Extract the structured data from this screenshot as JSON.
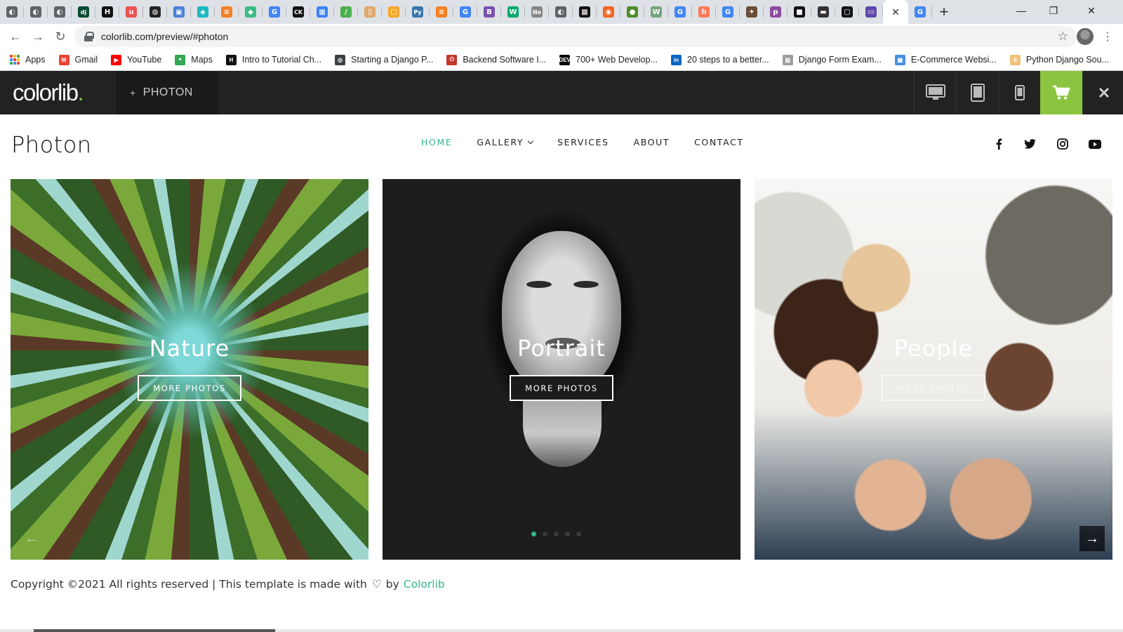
{
  "browser": {
    "tabs": [
      {
        "icon": "globe-icon",
        "color": "#5f6368",
        "glyph": "◐"
      },
      {
        "icon": "globe-icon",
        "color": "#5f6368",
        "glyph": "◐"
      },
      {
        "icon": "globe-icon",
        "color": "#5f6368",
        "glyph": "◐"
      },
      {
        "icon": "django-icon",
        "color": "#0c4b33",
        "glyph": "dj"
      },
      {
        "icon": "hackernoon-icon",
        "color": "#111111",
        "glyph": "H"
      },
      {
        "icon": "udemy-icon",
        "color": "#ec5252",
        "glyph": "u"
      },
      {
        "icon": "github-icon",
        "color": "#222222",
        "glyph": "◍"
      },
      {
        "icon": "gmail-icon",
        "color": "#4a7fd4",
        "glyph": "▣"
      },
      {
        "icon": "teal-icon",
        "color": "#1db9c3",
        "glyph": "◈"
      },
      {
        "icon": "stackoverflow-icon",
        "color": "#f48024",
        "glyph": "≡"
      },
      {
        "icon": "shield-icon",
        "color": "#3dbb86",
        "glyph": "◆"
      },
      {
        "icon": "google-icon",
        "color": "#4285f4",
        "glyph": "G"
      },
      {
        "icon": "ck-icon",
        "color": "#111111",
        "glyph": "CK"
      },
      {
        "icon": "grid-icon",
        "color": "#3b82f6",
        "glyph": "▦"
      },
      {
        "icon": "pen-icon",
        "color": "#4caf50",
        "glyph": "/"
      },
      {
        "icon": "doc-icon",
        "color": "#e0a96d",
        "glyph": "▯"
      },
      {
        "icon": "orange-icon",
        "color": "#f5a623",
        "glyph": "▢"
      },
      {
        "icon": "python-icon",
        "color": "#3776ab",
        "glyph": "Py"
      },
      {
        "icon": "stackoverflow-icon",
        "color": "#f48024",
        "glyph": "≡"
      },
      {
        "icon": "google-icon",
        "color": "#4285f4",
        "glyph": "G"
      },
      {
        "icon": "bootstrap-icon",
        "color": "#7952b3",
        "glyph": "B"
      },
      {
        "icon": "w3schools-icon",
        "color": "#04aa6d",
        "glyph": "W"
      },
      {
        "icon": "new-icon",
        "color": "#888888",
        "glyph": "Ne"
      },
      {
        "icon": "globe-icon",
        "color": "#5f6368",
        "glyph": "◐"
      },
      {
        "icon": "qr-icon",
        "color": "#111111",
        "glyph": "▩"
      },
      {
        "icon": "orange-icon",
        "color": "#f26522",
        "glyph": "◉"
      },
      {
        "icon": "green-icon",
        "color": "#4c8c2b",
        "glyph": "●"
      },
      {
        "icon": "w-icon",
        "color": "#74a57f",
        "glyph": "W"
      },
      {
        "icon": "google-icon",
        "color": "#4285f4",
        "glyph": "G"
      },
      {
        "icon": "hubspot-icon",
        "color": "#ff7a59",
        "glyph": "h"
      },
      {
        "icon": "google-icon",
        "color": "#4285f4",
        "glyph": "G"
      },
      {
        "icon": "bird-icon",
        "color": "#6b4d3a",
        "glyph": "✦"
      },
      {
        "icon": "p-icon",
        "color": "#8e4aa0",
        "glyph": "p"
      },
      {
        "icon": "black-icon",
        "color": "#111111",
        "glyph": "■"
      },
      {
        "icon": "car-icon",
        "color": "#333333",
        "glyph": "▬"
      },
      {
        "icon": "window-icon",
        "color": "#111111",
        "glyph": "▢"
      },
      {
        "icon": "colorlib-icon",
        "color": "#5e4aa8",
        "glyph": "▭"
      }
    ],
    "active_tab_close": "✕",
    "last_tab": {
      "icon": "google-icon",
      "color": "#4285f4",
      "glyph": "G"
    },
    "new_tab": "+",
    "window_controls": {
      "minimize": "—",
      "restore": "❐",
      "close": "✕"
    },
    "url": "colorlib.com/preview/#photon",
    "bookmarks": [
      {
        "label": "Apps",
        "icon": "apps-grid-icon",
        "color": "#4285f4",
        "glyph": ""
      },
      {
        "label": "Gmail",
        "icon": "gmail-icon",
        "color": "#ea4335",
        "glyph": "M"
      },
      {
        "label": "YouTube",
        "icon": "youtube-icon",
        "color": "#ff0000",
        "glyph": "▶"
      },
      {
        "label": "Maps",
        "icon": "maps-icon",
        "color": "#34a853",
        "glyph": "⌖"
      },
      {
        "label": "Intro to Tutorial Ch...",
        "icon": "hackernoon-icon",
        "color": "#111111",
        "glyph": "H"
      },
      {
        "label": "Starting a Django P...",
        "icon": "globe-icon",
        "color": "#3c4043",
        "glyph": "◎"
      },
      {
        "label": "Backend Software I...",
        "icon": "power-icon",
        "color": "#c0392b",
        "glyph": "⏻"
      },
      {
        "label": "700+ Web Develop...",
        "icon": "dev-icon",
        "color": "#0a0a0a",
        "glyph": "DEV"
      },
      {
        "label": "20 steps to a better...",
        "icon": "linkedin-icon",
        "color": "#0a66c2",
        "glyph": "in"
      },
      {
        "label": "Django Form Exam...",
        "icon": "bars-icon",
        "color": "#9e9e9e",
        "glyph": "▥"
      },
      {
        "label": "E-Commerce Websi...",
        "icon": "ecommerce-icon",
        "color": "#4a90e2",
        "glyph": "▦"
      },
      {
        "label": "Python Django Sou...",
        "icon": "python-source-icon",
        "color": "#f0c27a",
        "glyph": "S"
      }
    ]
  },
  "colorlib_bar": {
    "logo_text": "colorlib",
    "logo_dot": ".",
    "theme_label": "PHOTON",
    "plus": "+",
    "devices": [
      "desktop-icon",
      "tablet-icon",
      "mobile-icon"
    ],
    "cart_icon": "cart-icon",
    "close_icon": "close-icon",
    "accent": "#8bc540"
  },
  "site": {
    "brand": "Photon",
    "nav": [
      {
        "label": "HOME",
        "active": true
      },
      {
        "label": "GALLERY",
        "dropdown": true
      },
      {
        "label": "SERVICES"
      },
      {
        "label": "ABOUT"
      },
      {
        "label": "CONTACT"
      }
    ],
    "social": [
      "facebook-icon",
      "twitter-icon",
      "instagram-icon",
      "youtube-icon"
    ],
    "accent": "#33b68f"
  },
  "slides": [
    {
      "title": "Nature",
      "button": "MORE PHOTOS"
    },
    {
      "title": "Portrait",
      "button": "MORE PHOTOS"
    },
    {
      "title": "People",
      "button": "MORE PHOTOS"
    }
  ],
  "carousel": {
    "prev": "←",
    "next": "→",
    "dot_count": 5,
    "active_dot": 0
  },
  "footer": {
    "text": "Copyright ©2021 All rights reserved | This template is made with",
    "heart": "♡",
    "by": "by",
    "link": "Colorlib"
  }
}
